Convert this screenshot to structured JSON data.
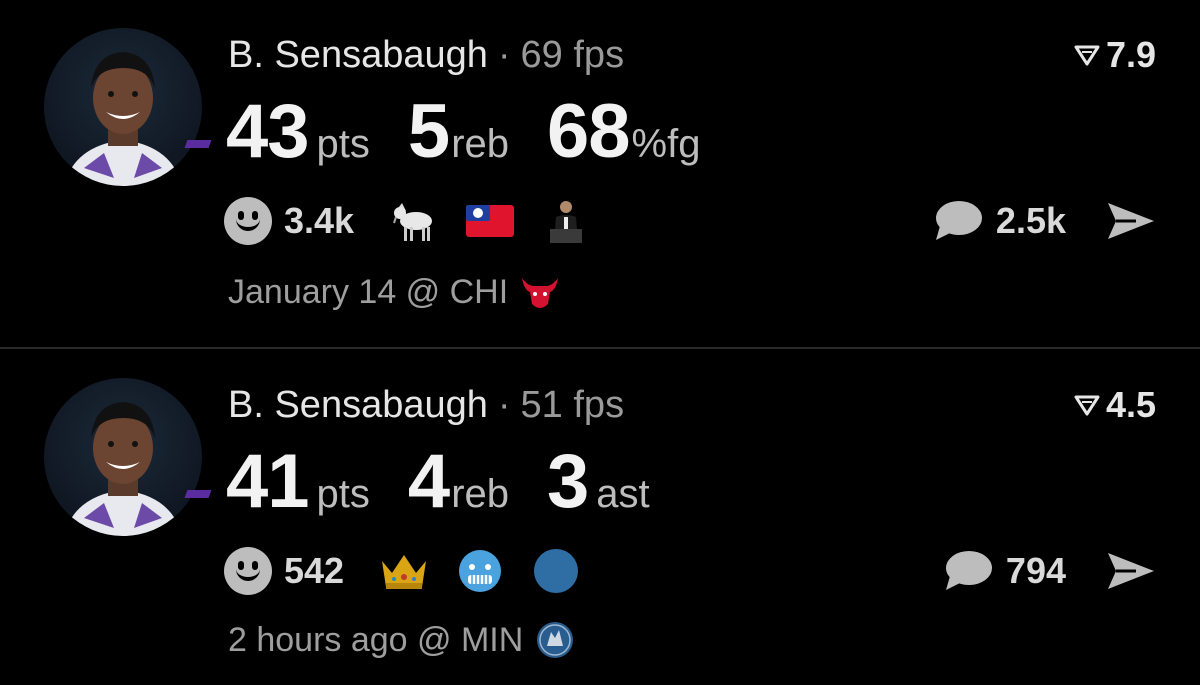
{
  "posts": [
    {
      "player_name": "B. Sensabaugh",
      "separator": "·",
      "fps": "69 fps",
      "rating": "7.9",
      "stats": [
        {
          "value": "43",
          "unit": "pts"
        },
        {
          "value": "5",
          "unit": "reb"
        },
        {
          "value": "68",
          "unit": "%fg"
        }
      ],
      "smile_count": "3.4k",
      "reaction_icons": [
        "goat-emoji",
        "taiwan-flag-emoji",
        "presenter-emoji"
      ],
      "comment_count": "2.5k",
      "footer_text": "January 14 @ CHI",
      "team_logo": "bulls-logo-icon"
    },
    {
      "player_name": "B. Sensabaugh",
      "separator": "·",
      "fps": "51 fps",
      "rating": "4.5",
      "stats": [
        {
          "value": "41",
          "unit": "pts"
        },
        {
          "value": "4",
          "unit": "reb"
        },
        {
          "value": "3",
          "unit": "ast"
        }
      ],
      "smile_count": "542",
      "reaction_icons": [
        "crown-emoji",
        "cold-face-emoji",
        "blue-circle-emoji"
      ],
      "comment_count": "794",
      "footer_text": "2 hours ago @ MIN",
      "team_logo": "timberwolves-logo-icon"
    }
  ],
  "colors": {
    "background": "#000000",
    "primary_text": "#f2f2f2",
    "muted_text": "#9e9e9e",
    "icon_gray": "#bdbdbd",
    "team_purple": "#5a2ca0"
  }
}
